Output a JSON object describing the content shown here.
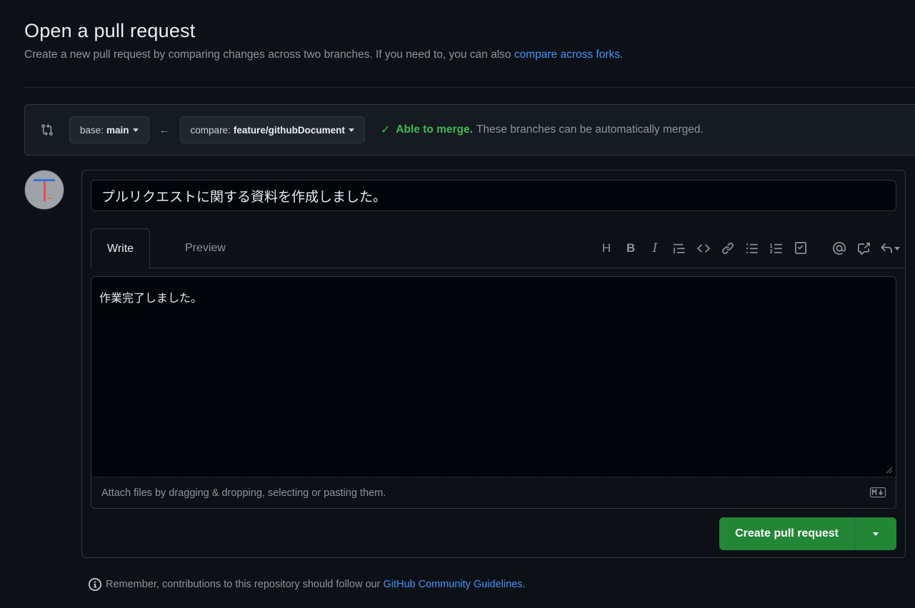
{
  "header": {
    "title": "Open a pull request",
    "subtitle": "Create a new pull request by comparing changes across two branches. If you need to, you can also",
    "subtitle_link": "compare across forks",
    "subtitle_end": "."
  },
  "range": {
    "base_prefix": "base:",
    "base_branch": "main",
    "compare_prefix": "compare:",
    "compare_branch": "feature/githubDocument",
    "status_ok": "Able to merge.",
    "status_detail": "These branches can be automatically merged."
  },
  "form": {
    "title_value": "プルリクエストに関する資料を作成しました。",
    "tabs": [
      {
        "label": "Write"
      },
      {
        "label": "Preview"
      }
    ],
    "toolbar": {
      "heading_label": "H",
      "bold_label": "B",
      "italic_label": "I"
    },
    "body_value": "作業完了しました。",
    "attach_hint": "Attach files by dragging & dropping, selecting or pasting them.",
    "create_label": "Create pull request"
  },
  "footer": {
    "note": "Remember, contributions to this repository should follow our",
    "link": "GitHub Community Guidelines",
    "end": "."
  },
  "colors": {
    "background": "#0d1117",
    "accent_green": "#238636",
    "link_blue": "#4493f8",
    "success_green": "#3fb950"
  }
}
